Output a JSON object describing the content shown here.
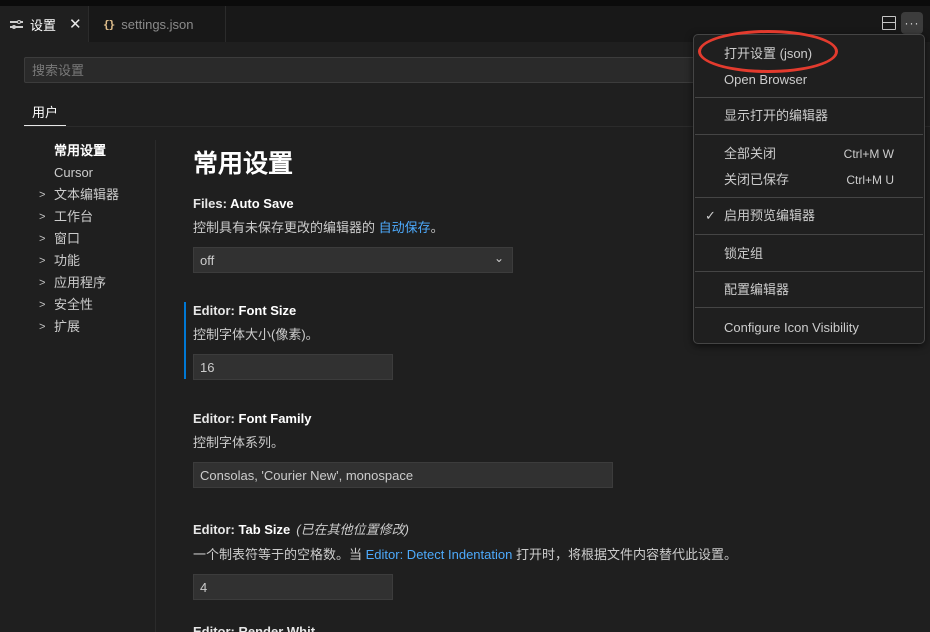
{
  "tabs": {
    "settings_label": "设置",
    "json_icon": "{}",
    "json_label": "settings.json",
    "close": "✕"
  },
  "toolbar": {
    "more": "···"
  },
  "search": {
    "placeholder": "搜索设置"
  },
  "scope": {
    "user": "用户"
  },
  "toc": [
    {
      "label": "常用设置",
      "expandable": false
    },
    {
      "label": "Cursor",
      "expandable": false
    },
    {
      "label": "文本编辑器",
      "expandable": true
    },
    {
      "label": "工作台",
      "expandable": true
    },
    {
      "label": "窗口",
      "expandable": true
    },
    {
      "label": "功能",
      "expandable": true
    },
    {
      "label": "应用程序",
      "expandable": true
    },
    {
      "label": "安全性",
      "expandable": true
    },
    {
      "label": "扩展",
      "expandable": true
    }
  ],
  "page_title": "常用设置",
  "settings": {
    "auto_save": {
      "category": "Files: ",
      "key": "Auto Save",
      "desc_prefix": "控制具有未保存更改的编辑器的 ",
      "desc_link": "自动保存",
      "desc_suffix": "。",
      "value": "off"
    },
    "font_size": {
      "category": "Editor: ",
      "key": "Font Size",
      "desc": "控制字体大小(像素)。",
      "value": "16"
    },
    "font_family": {
      "category": "Editor: ",
      "key": "Font Family",
      "desc": "控制字体系列。",
      "value": "Consolas, 'Courier New', monospace"
    },
    "tab_size": {
      "category": "Editor: ",
      "key": "Tab Size",
      "modified": "(已在其他位置修改)",
      "desc_prefix": "一个制表符等于的空格数。当 ",
      "desc_link": "Editor: Detect Indentation",
      "desc_suffix": " 打开时，将根据文件内容替代此设置。",
      "value": "4"
    },
    "next_partial": "Editor: Render Whit"
  },
  "menu": {
    "open_json": "打开设置 (json)",
    "open_browser": "Open Browser",
    "show_opened": "显示打开的编辑器",
    "close_all": "全部关闭",
    "close_all_kb": "Ctrl+M W",
    "close_saved": "关闭已保存",
    "close_saved_kb": "Ctrl+M U",
    "enable_preview": "启用预览编辑器",
    "check": "✓",
    "lock_group": "锁定组",
    "configure_editors": "配置编辑器",
    "configure_icon": "Configure Icon Visibility"
  },
  "colors": {
    "background": "#1f1f1f",
    "link": "#4daafc",
    "focus": "#0078d4",
    "annotation": "#e33b2e"
  }
}
